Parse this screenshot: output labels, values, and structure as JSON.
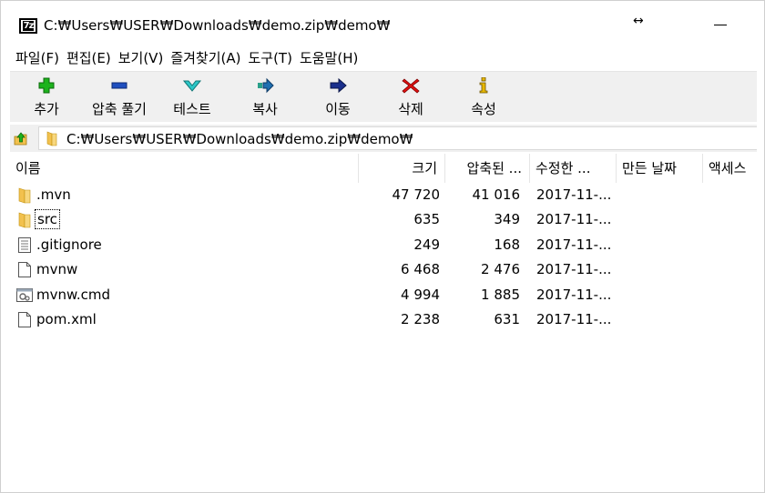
{
  "window": {
    "title": "C:₩Users₩USER₩Downloads₩demo.zip₩demo₩",
    "app_icon_label": "7z",
    "resize_glyph": "↔"
  },
  "menu": [
    {
      "label": "파일(F)"
    },
    {
      "label": "편집(E)"
    },
    {
      "label": "보기(V)"
    },
    {
      "label": "즐겨찾기(A)"
    },
    {
      "label": "도구(T)"
    },
    {
      "label": "도움말(H)"
    }
  ],
  "toolbar": [
    {
      "label": "추가",
      "icon": "plus-icon"
    },
    {
      "label": "압축 풀기",
      "icon": "minus-icon"
    },
    {
      "label": "테스트",
      "icon": "check-icon"
    },
    {
      "label": "복사",
      "icon": "copy-arrow-icon"
    },
    {
      "label": "이동",
      "icon": "move-arrow-icon"
    },
    {
      "label": "삭제",
      "icon": "delete-x-icon"
    },
    {
      "label": "속성",
      "icon": "info-icon"
    }
  ],
  "address": {
    "path": "C:₩Users₩USER₩Downloads₩demo.zip₩demo₩"
  },
  "columns": {
    "name": "이름",
    "size": "크기",
    "packed": "압축된 ...",
    "modified": "수정한 ...",
    "created": "만든 날짜",
    "accessed": "액세스"
  },
  "files": [
    {
      "name": ".mvn",
      "type": "folder",
      "size": "47 720",
      "packed": "41 016",
      "modified": "2017-11-..."
    },
    {
      "name": "src",
      "type": "folder",
      "size": "635",
      "packed": "349",
      "modified": "2017-11-..."
    },
    {
      "name": ".gitignore",
      "type": "text",
      "size": "249",
      "packed": "168",
      "modified": "2017-11-..."
    },
    {
      "name": "mvnw",
      "type": "file",
      "size": "6 468",
      "packed": "2 476",
      "modified": "2017-11-..."
    },
    {
      "name": "mvnw.cmd",
      "type": "cmd",
      "size": "4 994",
      "packed": "1 885",
      "modified": "2017-11-..."
    },
    {
      "name": "pom.xml",
      "type": "file",
      "size": "2 238",
      "packed": "631",
      "modified": "2017-11-..."
    }
  ],
  "colors": {
    "toolbar_bg": "#f0f0f0",
    "folder": "#f2c14e",
    "add_green": "#1db31d",
    "extract_blue": "#1f4fbf",
    "test_cyan": "#2cc7c7",
    "delete_red": "#e01010",
    "info_yellow": "#e8b800"
  }
}
